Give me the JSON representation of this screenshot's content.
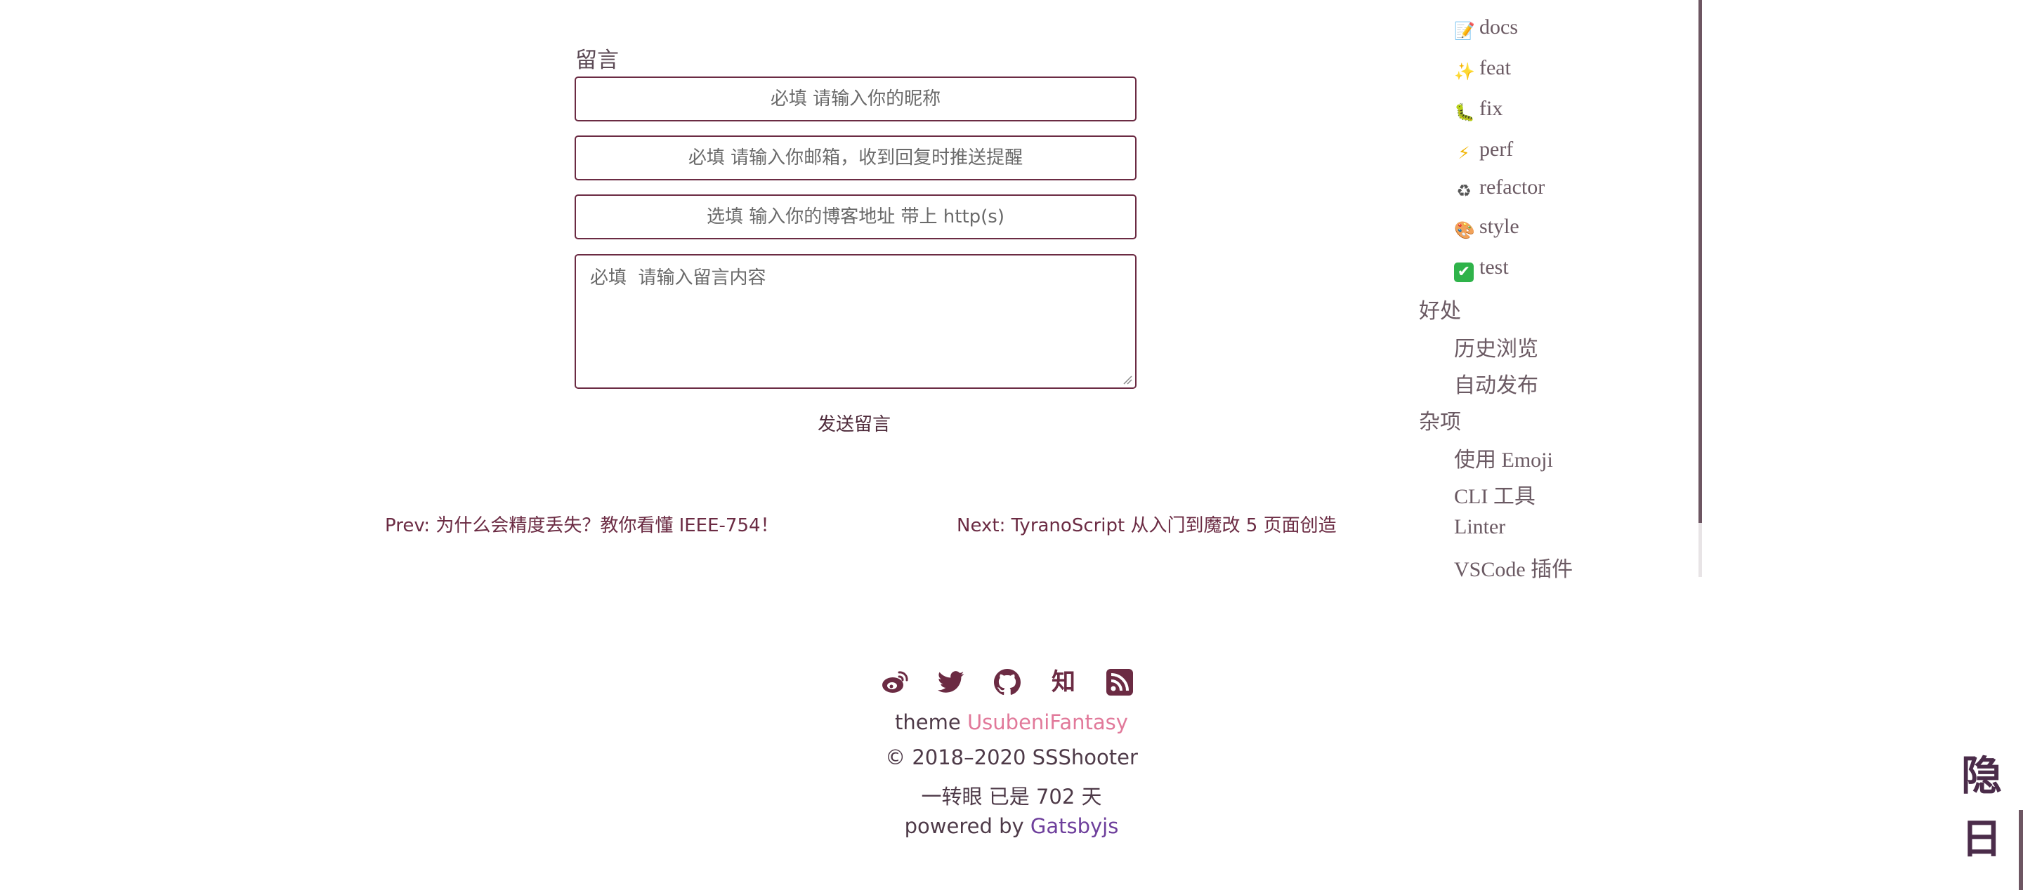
{
  "comment_form": {
    "title": "留言",
    "nickname_placeholder": "必填 请输入你的昵称",
    "email_placeholder": "必填 请输入你邮箱，收到回复时推送提醒",
    "website_placeholder": "选填 输入你的博客地址 带上 http(s)",
    "content_placeholder": "必填  请输入留言内容",
    "submit_label": "发送留言"
  },
  "post_nav": {
    "prev": "Prev: 为什么会精度丢失？教你看懂 IEEE-754！",
    "next": "Next: TyranoScript 从入门到魔改 5 页面创造"
  },
  "toc": {
    "items": [
      {
        "label": "docs",
        "emoji": "📝",
        "icon": "memo-icon"
      },
      {
        "label": "feat",
        "emoji": "✨",
        "icon": "sparkles-icon"
      },
      {
        "label": "fix",
        "emoji": "🐛",
        "icon": "bug-icon"
      },
      {
        "label": "perf",
        "emoji": "⚡",
        "icon": "zap-icon"
      },
      {
        "label": "refactor",
        "emoji": "♻",
        "icon": "recycle-icon"
      },
      {
        "label": "style",
        "emoji": "🎨",
        "icon": "art-icon"
      },
      {
        "label": "test",
        "emoji": "✔",
        "icon": "check-mark-icon"
      }
    ],
    "section_benefits": "好处",
    "benefits": [
      "历史浏览",
      "自动发布"
    ],
    "section_misc": "杂项",
    "misc": [
      "使用 Emoji",
      "CLI 工具",
      "Linter",
      "VSCode 插件"
    ]
  },
  "footer": {
    "social_icons": [
      "weibo-icon",
      "twitter-icon",
      "github-icon",
      "zhihu-icon",
      "rss-icon"
    ],
    "zhihu_glyph": "知",
    "theme_prefix": "theme ",
    "theme_name": "UsubeniFantasy",
    "copyright": "© 2018–2020 SSShooter",
    "uptime": "一转眼 已是 702 天",
    "powered_prefix": "powered by ",
    "powered_name": "Gatsbyjs"
  },
  "side_buttons": {
    "hide": "隐",
    "day": "日"
  },
  "colors": {
    "accent": "#6b2b43",
    "theme_link": "#e1799a",
    "gatsby_link": "#6e3f9c"
  }
}
